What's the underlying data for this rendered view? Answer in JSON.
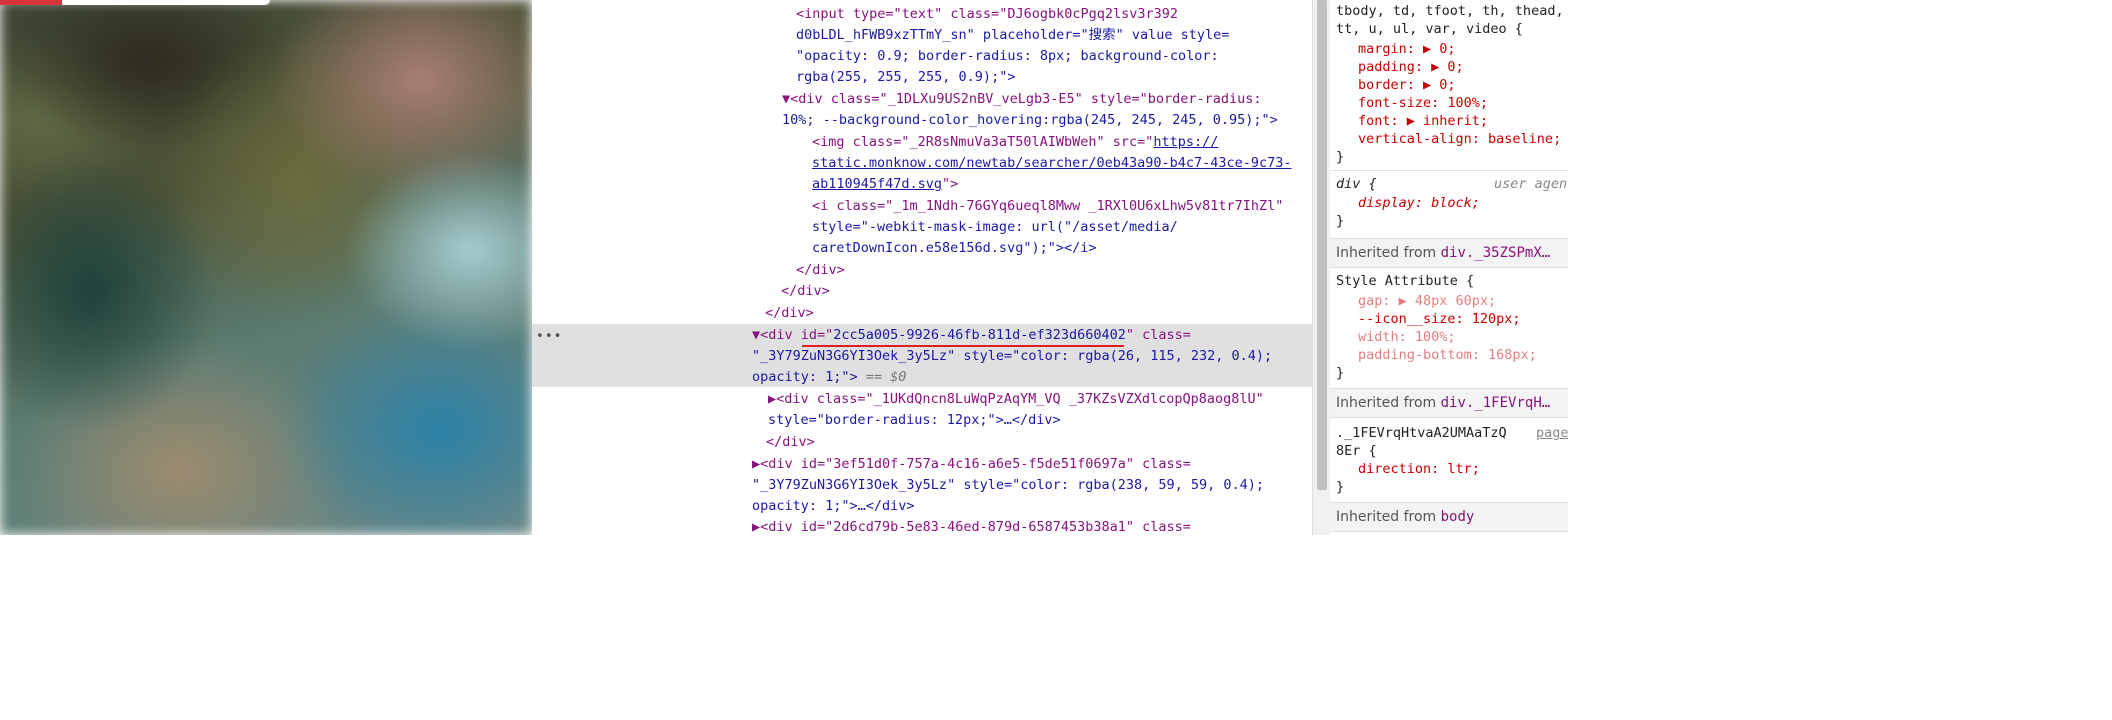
{
  "elements_panel": {
    "lines": [
      "<input type=\"text\" class=\"DJ6ogbk0cPgq2lsv3r392",
      "d0bLDL_hFWB9xzTTmY_sn\" placeholder=\"搜索\" value style=",
      "\"opacity: 0.9; border-radius: 8px; background-color:",
      "rgba(255, 255, 255, 0.9);\">",
      "▼<div class=\"_1DLXu9US2nBV_veLgb3-E5\" style=\"border-radius:",
      "10%; --background-color_hovering:rgba(245, 245, 245, 0.95);\">",
      "<img class=\"_2R8sNmuVa3aT50lAIWbWeh\" src=\"",
      "https://",
      "static.monknow.com/newtab/searcher/0eb43a90-b4c7-43ce-9c73-",
      "ab110945f47d.svg",
      "\">",
      "<i class=\"_1m_1Ndh-76GYq6ueql8Mww _1RXl0U6xLhw5v81tr7IhZl\"",
      "style=\"-webkit-mask-image: url(\"/asset/media/",
      "caretDownIcon.e58e156d.svg\");\"></i>",
      "</div>",
      "</div>",
      "</div>",
      "▼<div id=\"",
      "2cc5a005-9926-46fb-811d-ef323d660402",
      "\" class=",
      "\"_3Y79ZuN3G6YI3Oek_3y5Lz\" style=\"color: rgba(26, 115, 232, 0.4);",
      "opacity: 1;\">",
      " == $0",
      "▶<div class=\"_1UKdQncn8LuWqPzAqYM_VQ _37KZsVZXdlcopQp8aog8lU\"",
      "style=\"border-radius: 12px;\">…</div>",
      "</div>",
      "▶<div id=\"3ef51d0f-757a-4c16-a6e5-f5de51f0697a\" class=",
      "\"_3Y79ZuN3G6YI3Oek_3y5Lz\" style=\"color: rgba(238, 59, 59, 0.4);",
      "opacity: 1;\">…</div>",
      "▶<div id=\"2d6cd79b-5e83-46ed-879d-6587453b38a1\" class="
    ],
    "dots": "•••"
  },
  "styles_panel": {
    "lines": [
      "tbody, td, tfoot, th, thead,",
      "tt, u, ul, var, video {",
      "margin: ▶ 0;",
      "padding: ▶ 0;",
      "border: ▶ 0;",
      "font-size: 100%;",
      "font: ▶ inherit;",
      "vertical-align: baseline;",
      "}",
      "div {",
      "user agent",
      "display: block;",
      "}",
      "Inherited from ",
      "div._35ZSPmX…",
      "Style Attribute {",
      "gap: ▶ 48px 60px;",
      "--icon__size: 120px;",
      "width: 100%;",
      "padding-bottom: 168px;",
      "}",
      "Inherited from ",
      "div._1FEVrqH…",
      "._1FEVrqHtvaA2UMAaTzQ",
      "page",
      "8Er {",
      "direction: ltr;",
      "}",
      "Inherited from ",
      "body"
    ]
  },
  "colors": {
    "highlight_row": "#e0e0e0",
    "underline": "#e02020",
    "tab_red": "#d8323c"
  }
}
